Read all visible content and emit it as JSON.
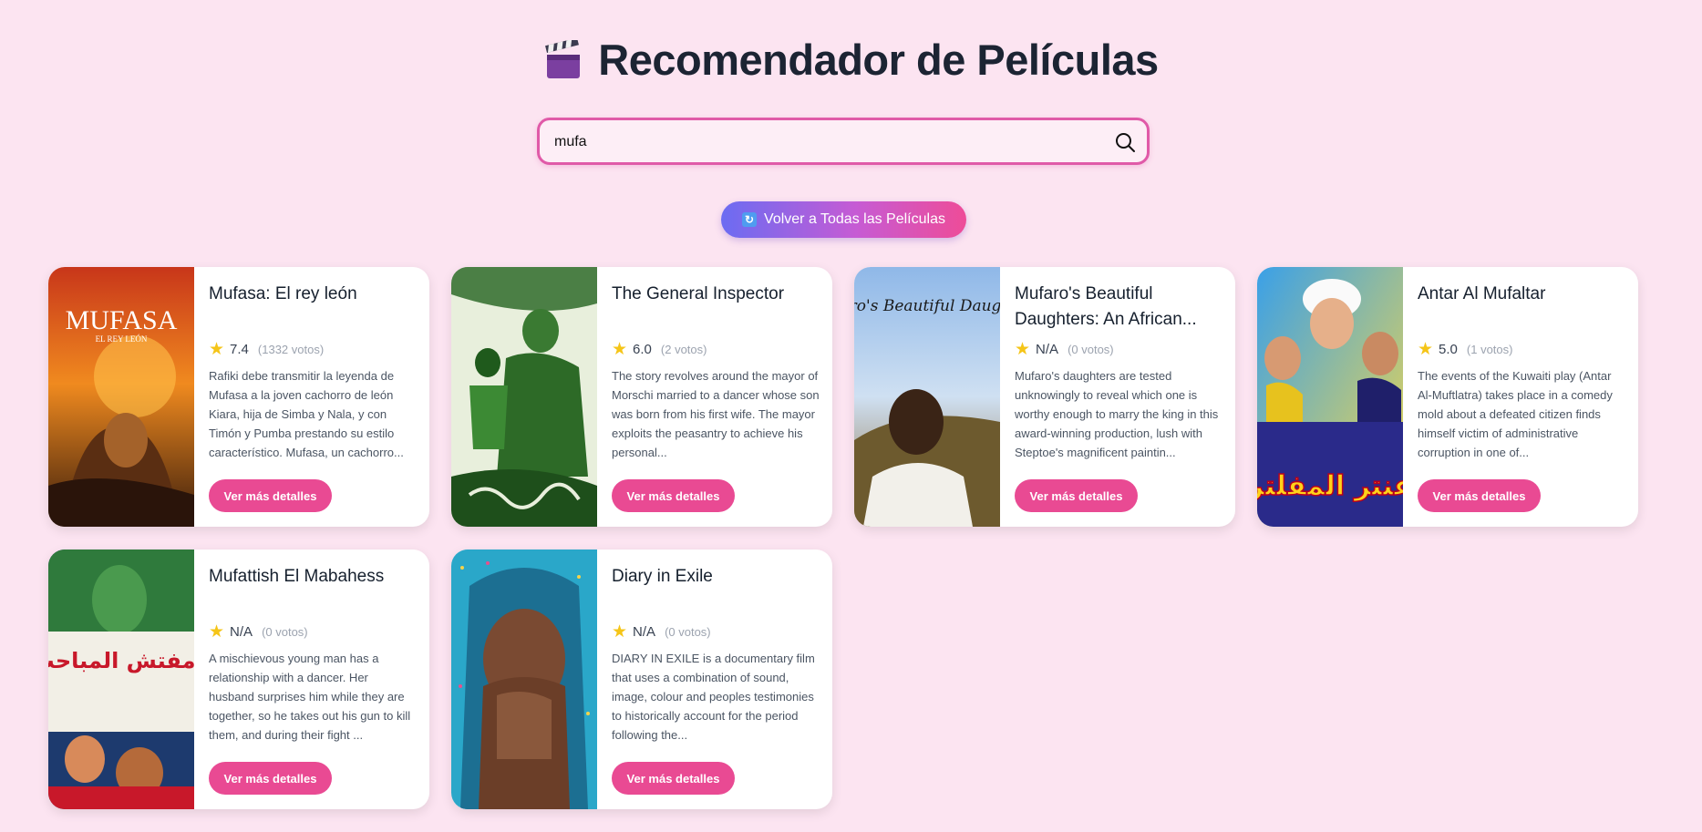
{
  "header": {
    "title": "Recomendador de Películas",
    "icon": "clapperboard-icon"
  },
  "search": {
    "value": "mufa",
    "placeholder": ""
  },
  "back_button": {
    "label": "Volver a Todas las Películas",
    "icon": "refresh-icon"
  },
  "colors": {
    "background": "#fce4f1",
    "accent": "#e94a93",
    "search_border": "#e05aa8",
    "star": "#f5c518"
  },
  "movies": [
    {
      "title": "Mufasa: El rey león",
      "rating": "7.4",
      "votes": "(1332 votos)",
      "description": "Rafiki debe transmitir la leyenda de Mufasa a la joven cachorro de león Kiara, hija de Simba y Nala, y con Timón y Pumba prestando su estilo característico. Mufasa, un cachorro...",
      "button": "Ver más detalles",
      "poster_text": "MUFASA",
      "poster_subtext": "EL REY LEÓN"
    },
    {
      "title": "The General Inspector",
      "rating": "6.0",
      "votes": "(2 votos)",
      "description": "The story revolves around the mayor of Morschi married to a dancer whose son was born from his first wife. The mayor exploits the peasantry to achieve his personal...",
      "button": "Ver más detalles"
    },
    {
      "title": "Mufaro's Beautiful Daughters: An African...",
      "rating": "N/A",
      "votes": "(0 votos)",
      "description": "Mufaro's daughters are tested unknowingly to reveal which one is worthy enough to marry the king in this award-winning production, lush with Steptoe's magnificent paintin...",
      "button": "Ver más detalles",
      "poster_text": "Mufaro's Beautiful Daughters"
    },
    {
      "title": "Antar Al Mufaltar",
      "rating": "5.0",
      "votes": "(1 votos)",
      "description": "The events of the Kuwaiti play (Antar Al-Muftlatra) takes place in a comedy mold about a defeated citizen finds himself victim of administrative corruption in one of...",
      "button": "Ver más detalles",
      "poster_text": "عنتر المفلتر"
    },
    {
      "title": "Mufattish El Mabahess",
      "rating": "N/A",
      "votes": "(0 votos)",
      "description": "A mischievous young man has a relationship with a dancer. Her husband surprises him while they are together, so he takes out his gun to kill them, and during their fight ...",
      "button": "Ver más detalles",
      "poster_text": "مفتش المباحث"
    },
    {
      "title": "Diary in Exile",
      "rating": "N/A",
      "votes": "(0 votos)",
      "description": "DIARY IN EXILE is a documentary film that uses a combination of sound, image, colour and peoples testimonies to historically account for the period following the...",
      "button": "Ver más detalles"
    }
  ]
}
